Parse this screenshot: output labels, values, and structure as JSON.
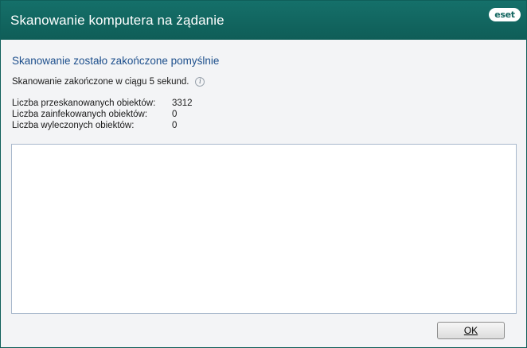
{
  "window": {
    "title": "Skanowanie komputera na żądanie",
    "logo": "eset",
    "colors": {
      "titlebar": "#12655f",
      "heading": "#1d4f8c"
    }
  },
  "result": {
    "heading": "Skanowanie zostało zakończone pomyślnie",
    "summary": "Skanowanie zakończone w ciągu 5 sekund.",
    "info_icon": "info-icon"
  },
  "stats": [
    {
      "label": "Liczba przeskanowanych obiektów:",
      "value": "3312"
    },
    {
      "label": "Liczba zainfekowanych obiektów:",
      "value": "0"
    },
    {
      "label": "Liczba wyleczonych obiektów:",
      "value": "0"
    }
  ],
  "buttons": {
    "ok": "OK"
  }
}
